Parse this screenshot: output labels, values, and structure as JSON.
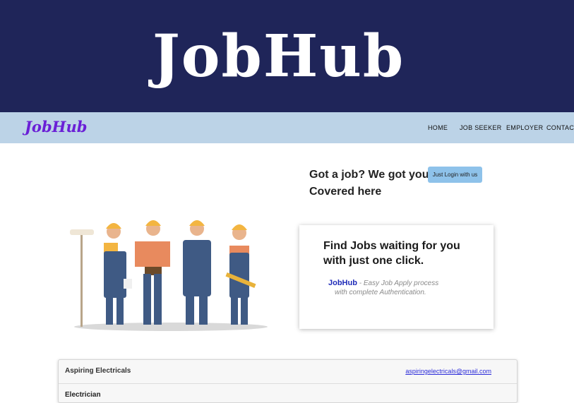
{
  "banner": {
    "title": "JobHub"
  },
  "navbar": {
    "logo": "JobHub",
    "links": [
      "HOME",
      "JOB SEEKER",
      "EMPLOYER",
      "CONTACT"
    ]
  },
  "hero": {
    "title": "Got a job? We got you Covered here",
    "login_label": "Just Login with us"
  },
  "illustration": {
    "icon": "construction-workers-illustration"
  },
  "card": {
    "heading": "Find Jobs waiting for you with just one click.",
    "brand": "JobHub",
    "tagline_line1": "- Easy Job Apply process",
    "tagline_line2": "with complete Authentication."
  },
  "job_listing": {
    "company": "Aspiring Electricals",
    "email": "aspiringelectricals@gmail.com",
    "title": "Electrician"
  }
}
